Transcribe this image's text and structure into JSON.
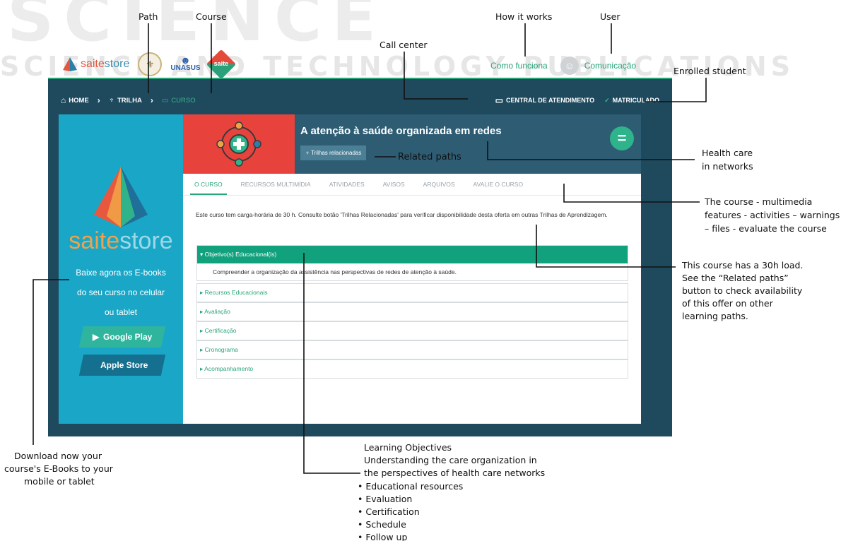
{
  "annotations": {
    "path": "Path",
    "course": "Course",
    "how_it_works": "How it works",
    "user": "User",
    "call_center": "Call center",
    "enrolled_student": "Enrolled student",
    "related_paths": "Related paths",
    "health_care_1": "Health care",
    "health_care_2": "in networks",
    "tabs_1": "The course - multimedia",
    "tabs_2": "features - activities – warnings",
    "tabs_3": "– files - evaluate the course",
    "load_1": "This course has a 30h load.",
    "load_2": "See the “Related paths”",
    "load_3": "button to check availability",
    "load_4": "of this offer on other",
    "load_5": "learning paths.",
    "download_1": "Download now your",
    "download_2": "course's E-Books to your",
    "download_3": "mobile or tablet",
    "objectives_1": "Learning Objectives",
    "objectives_2": "Understanding the care organization in",
    "objectives_3": "the perspectives of health care networks",
    "bullets": [
      "Educational resources",
      "Evaluation",
      "Certification",
      "Schedule",
      "Follow up"
    ]
  },
  "branding": {
    "saite_1": "saite",
    "saite_2": "store",
    "unasus": "UNASUS",
    "saite_badge": "saite"
  },
  "top_links": {
    "how_it_works": "Como funciona",
    "communication": "Comunicação"
  },
  "navbar": {
    "home": "HOME",
    "trail": "TRILHA",
    "course": "CURSO",
    "call_center": "CENTRAL DE ATENDIMENTO",
    "enrolled": "MATRICULADO"
  },
  "sidebar": {
    "brand_1": "saite",
    "brand_2": "store",
    "text_1": "Baixe agora os E-books",
    "text_2": "do seu curso no celular",
    "text_3": "ou tablet",
    "google_play": "Google Play",
    "apple_store": "Apple Store"
  },
  "course": {
    "title": "A atenção à saúde organizada em redes",
    "related_button": "Trilhas relacionadas",
    "fab": "="
  },
  "tabs": [
    "O CURSO",
    "RECURSOS MULTIMÍDIA",
    "ATIVIDADES",
    "AVISOS",
    "ARQUIVOS",
    "AVALIE O CURSO"
  ],
  "intro": "Este curso tem carga-horária de 30 h. Consulte botão 'Trilhas Relacionadas' para verificar disponibilidade desta oferta em outras Trilhas de Aprendizagem.",
  "accordion": [
    {
      "title": "Objetivo(s) Educacional(is)",
      "body": "Compreender a organização da assistência nas perspectivas de redes de atenção à saúde."
    },
    {
      "title": "Recursos Educacionais"
    },
    {
      "title": "Avaliação"
    },
    {
      "title": "Certificação"
    },
    {
      "title": "Cronograma"
    },
    {
      "title": "Acompanhamento"
    }
  ],
  "colors": {
    "accent_green": "#12a17d",
    "navy": "#1f4a5e",
    "sidebar_blue": "#1aa7c7",
    "hero_red": "#e8423d"
  }
}
